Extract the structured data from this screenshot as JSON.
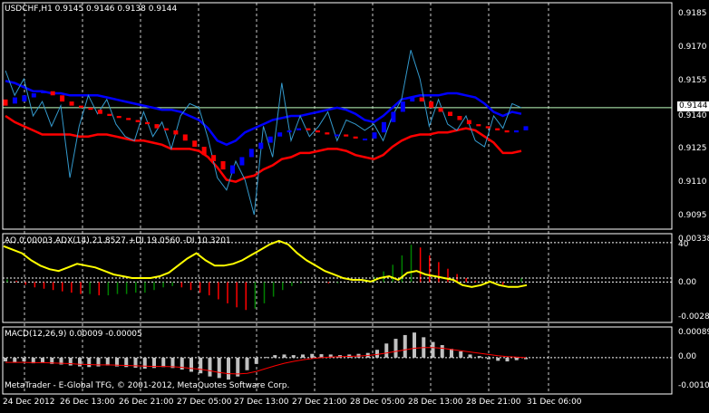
{
  "symbol_header": "USDCHF,H1  0.9145 0.9146 0.9138 0.9144",
  "ao_header": "AO 0.00003  ADX(14) 21.8527 +DI 19.0560 -DI 10.3201",
  "macd_header": "MACD(12,26,9) 0.00009 -0.00005",
  "footer": "MetaTrader - E-Global TFG, © 2001-2012, MetaQuotes Software Corp.",
  "price_axis": [
    "0.9185",
    "0.9170",
    "0.9155",
    "0.9140",
    "0.9125",
    "0.9110",
    "0.9095"
  ],
  "current_price": "0.9144",
  "ao_axis": [
    "0.00338",
    "40",
    "0.00",
    "-0.00281"
  ],
  "macd_axis": [
    "0.00089",
    "0.00",
    "-0.00106"
  ],
  "time_labels": [
    "24 Dec 2012",
    "26 Dec 13:00",
    "26 Dec 21:00",
    "27 Dec 05:00",
    "27 Dec 13:00",
    "27 Dec 21:00",
    "28 Dec 05:00",
    "28 Dec 13:00",
    "28 Dec 21:00",
    "31 Dec 06:00"
  ],
  "colors": {
    "bull": "#0000ff",
    "bear": "#ff0000",
    "upper_band": "#0000ff",
    "lower_band": "#ff0000",
    "price_line": "#3399cc",
    "adx": "#ffff00",
    "ao_up": "#008000",
    "ao_down": "#ff0000",
    "macd_hist": "#c0c0c0",
    "macd_signal": "#ff0000",
    "current_price_line": "#c0ffc0"
  },
  "chart_data": {
    "type": "line",
    "title": "USDCHF,H1",
    "ylim": [
      0.9085,
      0.9195
    ],
    "price_line": [
      0.9162,
      0.915,
      0.9158,
      0.914,
      0.9147,
      0.9135,
      0.9145,
      0.911,
      0.9135,
      0.915,
      0.9141,
      0.9148,
      0.9136,
      0.913,
      0.9128,
      0.9142,
      0.913,
      0.9137,
      0.9124,
      0.914,
      0.9146,
      0.9144,
      0.9129,
      0.911,
      0.9104,
      0.9118,
      0.9109,
      0.9092,
      0.9135,
      0.912,
      0.9156,
      0.9128,
      0.914,
      0.913,
      0.9135,
      0.9142,
      0.9128,
      0.9138,
      0.9136,
      0.9133,
      0.9136,
      0.9128,
      0.914,
      0.9148,
      0.9172,
      0.9158,
      0.9135,
      0.9148,
      0.9136,
      0.9133,
      0.914,
      0.9128,
      0.9125,
      0.914,
      0.9134,
      0.9146,
      0.9144
    ],
    "upper_band": [
      0.9157,
      0.9156,
      0.9154,
      0.9152,
      0.9152,
      0.9151,
      0.9151,
      0.915,
      0.915,
      0.915,
      0.915,
      0.9149,
      0.9148,
      0.9147,
      0.9146,
      0.9145,
      0.9144,
      0.9143,
      0.9143,
      0.9142,
      0.914,
      0.9138,
      0.9134,
      0.9128,
      0.9126,
      0.9128,
      0.9132,
      0.9134,
      0.9136,
      0.9138,
      0.9139,
      0.914,
      0.914,
      0.9141,
      0.9142,
      0.9143,
      0.9144,
      0.9143,
      0.9141,
      0.9138,
      0.9137,
      0.914,
      0.9144,
      0.9148,
      0.9149,
      0.915,
      0.915,
      0.915,
      0.9151,
      0.9151,
      0.915,
      0.9149,
      0.9146,
      0.9142,
      0.914,
      0.9142,
      0.9141
    ],
    "lower_band": [
      0.914,
      0.9137,
      0.9135,
      0.9133,
      0.9131,
      0.9131,
      0.9131,
      0.9131,
      0.913,
      0.913,
      0.9131,
      0.9131,
      0.913,
      0.9129,
      0.9128,
      0.9128,
      0.9127,
      0.9126,
      0.9124,
      0.9124,
      0.9124,
      0.9123,
      0.912,
      0.9115,
      0.9109,
      0.9108,
      0.911,
      0.9111,
      0.9114,
      0.9116,
      0.9119,
      0.912,
      0.9122,
      0.9122,
      0.9123,
      0.9124,
      0.9124,
      0.9123,
      0.9121,
      0.912,
      0.9119,
      0.9121,
      0.9125,
      0.9128,
      0.913,
      0.9131,
      0.9131,
      0.9132,
      0.9132,
      0.9133,
      0.9134,
      0.9133,
      0.913,
      0.9127,
      0.9122,
      0.9122,
      0.9123
    ],
    "candles": [
      {
        "o": 0.9148,
        "c": 0.9145
      },
      {
        "o": 0.9146,
        "c": 0.9149
      },
      {
        "o": 0.9147,
        "c": 0.915
      },
      {
        "o": 0.9149,
        "c": 0.9151
      },
      {
        "o": 0.9151,
        "c": 0.9152
      },
      {
        "o": 0.9152,
        "c": 0.915
      },
      {
        "o": 0.915,
        "c": 0.9147
      },
      {
        "o": 0.9147,
        "c": 0.9145
      },
      {
        "o": 0.9145,
        "c": 0.9144
      },
      {
        "o": 0.9144,
        "c": 0.9143
      },
      {
        "o": 0.9143,
        "c": 0.9141
      },
      {
        "o": 0.9141,
        "c": 0.914
      },
      {
        "o": 0.914,
        "c": 0.9139
      },
      {
        "o": 0.9139,
        "c": 0.9138
      },
      {
        "o": 0.9138,
        "c": 0.9137
      },
      {
        "o": 0.9137,
        "c": 0.9136
      },
      {
        "o": 0.9136,
        "c": 0.9134
      },
      {
        "o": 0.9134,
        "c": 0.9133
      },
      {
        "o": 0.9133,
        "c": 0.9131
      },
      {
        "o": 0.9131,
        "c": 0.9128
      },
      {
        "o": 0.9128,
        "c": 0.9125
      },
      {
        "o": 0.9125,
        "c": 0.9121
      },
      {
        "o": 0.9121,
        "c": 0.9118
      },
      {
        "o": 0.9118,
        "c": 0.9114
      },
      {
        "o": 0.9112,
        "c": 0.9116
      },
      {
        "o": 0.9116,
        "c": 0.912
      },
      {
        "o": 0.912,
        "c": 0.9124
      },
      {
        "o": 0.9124,
        "c": 0.9127
      },
      {
        "o": 0.9127,
        "c": 0.913
      },
      {
        "o": 0.913,
        "c": 0.9132
      },
      {
        "o": 0.9132,
        "c": 0.9133
      },
      {
        "o": 0.9133,
        "c": 0.9134
      },
      {
        "o": 0.9134,
        "c": 0.9133
      },
      {
        "o": 0.9133,
        "c": 0.9132
      },
      {
        "o": 0.9132,
        "c": 0.9131
      },
      {
        "o": 0.9131,
        "c": 0.9131
      },
      {
        "o": 0.9131,
        "c": 0.913
      },
      {
        "o": 0.913,
        "c": 0.9129
      },
      {
        "o": 0.9129,
        "c": 0.9129
      },
      {
        "o": 0.9129,
        "c": 0.9132
      },
      {
        "o": 0.9132,
        "c": 0.9137
      },
      {
        "o": 0.9137,
        "c": 0.9142
      },
      {
        "o": 0.9142,
        "c": 0.9147
      },
      {
        "o": 0.9147,
        "c": 0.9149
      },
      {
        "o": 0.9149,
        "c": 0.9147
      },
      {
        "o": 0.9147,
        "c": 0.9144
      },
      {
        "o": 0.9144,
        "c": 0.9142
      },
      {
        "o": 0.9142,
        "c": 0.914
      },
      {
        "o": 0.914,
        "c": 0.9138
      },
      {
        "o": 0.9138,
        "c": 0.9136
      },
      {
        "o": 0.9136,
        "c": 0.9135
      },
      {
        "o": 0.9135,
        "c": 0.9134
      },
      {
        "o": 0.9134,
        "c": 0.9133
      },
      {
        "o": 0.9133,
        "c": 0.9132
      },
      {
        "o": 0.9132,
        "c": 0.9133
      },
      {
        "o": 0.9133,
        "c": 0.9135
      }
    ],
    "ao": {
      "ylim": [
        -0.0029,
        0.0035
      ],
      "values": [
        0.0002,
        0.0001,
        -0.0002,
        -0.0004,
        -0.0005,
        -0.0006,
        -0.0007,
        -0.0008,
        -0.0009,
        -0.0009,
        -0.001,
        -0.001,
        -0.0009,
        -0.0009,
        -0.0008,
        -0.0008,
        -0.0006,
        -0.0004,
        -0.0003,
        -0.0004,
        -0.0006,
        -0.0008,
        -0.001,
        -0.0013,
        -0.0016,
        -0.0019,
        -0.0021,
        -0.002,
        -0.0016,
        -0.0011,
        -0.0006,
        -0.0003,
        -0.0001,
        0.0,
        0.0,
        -0.0001,
        -0.0001,
        0.0,
        0.0,
        0.0002,
        0.0004,
        0.0008,
        0.0013,
        0.002,
        0.0028,
        0.0026,
        0.002,
        0.0015,
        0.001,
        0.0006,
        0.0003,
        0.0001,
        0.0,
        -0.0001,
        -0.0002,
        0.0001,
        0.0003
      ]
    },
    "adx": {
      "ylim": [
        -4,
        44
      ],
      "values": [
        38,
        36,
        34,
        30,
        27,
        25,
        24,
        26,
        28,
        27,
        26,
        24,
        22,
        21,
        20,
        20,
        20,
        21,
        23,
        27,
        31,
        34,
        30,
        27,
        27,
        28,
        30,
        33,
        36,
        39,
        41,
        39,
        34,
        30,
        27,
        24,
        22,
        20,
        19,
        19,
        18,
        20,
        21,
        19,
        23,
        24,
        22,
        21,
        20,
        19,
        16,
        15,
        16,
        18,
        16,
        15,
        15,
        16
      ]
    },
    "macd": {
      "ylim": [
        -0.0011,
        0.00092
      ],
      "hist": [
        -0.00012,
        -0.00015,
        -0.00012,
        -0.00018,
        -0.00015,
        -0.0002,
        -0.00022,
        -0.00025,
        -0.00028,
        -0.0003,
        -0.00028,
        -0.00025,
        -0.00028,
        -0.0003,
        -0.00032,
        -0.00035,
        -0.00033,
        -0.0003,
        -0.00033,
        -0.00038,
        -0.00045,
        -0.0005,
        -0.0006,
        -0.00065,
        -0.0007,
        -0.0006,
        -0.0004,
        -0.0002,
        2e-05,
        8e-05,
        0.0001,
        8e-05,
        0.0001,
        0.00012,
        0.00011,
        0.0001,
        8e-05,
        0.0001,
        0.00012,
        0.00015,
        0.00025,
        0.00045,
        0.0006,
        0.00072,
        0.0008,
        0.00065,
        0.0005,
        0.0004,
        0.00028,
        0.0002,
        0.0001,
        5e-05,
        -5e-05,
        -0.0001,
        -0.00012,
        -8e-05,
        -5e-05
      ],
      "signal": [
        -0.00015,
        -0.00015,
        -0.00015,
        -0.00016,
        -0.00016,
        -0.00017,
        -0.00018,
        -0.00019,
        -0.00021,
        -0.00022,
        -0.00023,
        -0.00023,
        -0.00024,
        -0.00025,
        -0.00026,
        -0.00027,
        -0.00028,
        -0.00028,
        -0.00029,
        -0.00031,
        -0.00034,
        -0.00037,
        -0.00042,
        -0.00047,
        -0.00051,
        -0.00052,
        -0.0005,
        -0.00044,
        -0.00035,
        -0.00026,
        -0.00018,
        -0.00012,
        -7e-05,
        -3e-05,
        0.0,
        2e-05,
        3e-05,
        4e-05,
        5e-05,
        7e-05,
        0.0001,
        0.00015,
        0.0002,
        0.00025,
        0.0003,
        0.00032,
        0.00032,
        0.0003,
        0.00026,
        0.00022,
        0.00018,
        0.00014,
        0.0001,
        6e-05,
        3e-05,
        2e-05,
        0.0
      ]
    }
  }
}
